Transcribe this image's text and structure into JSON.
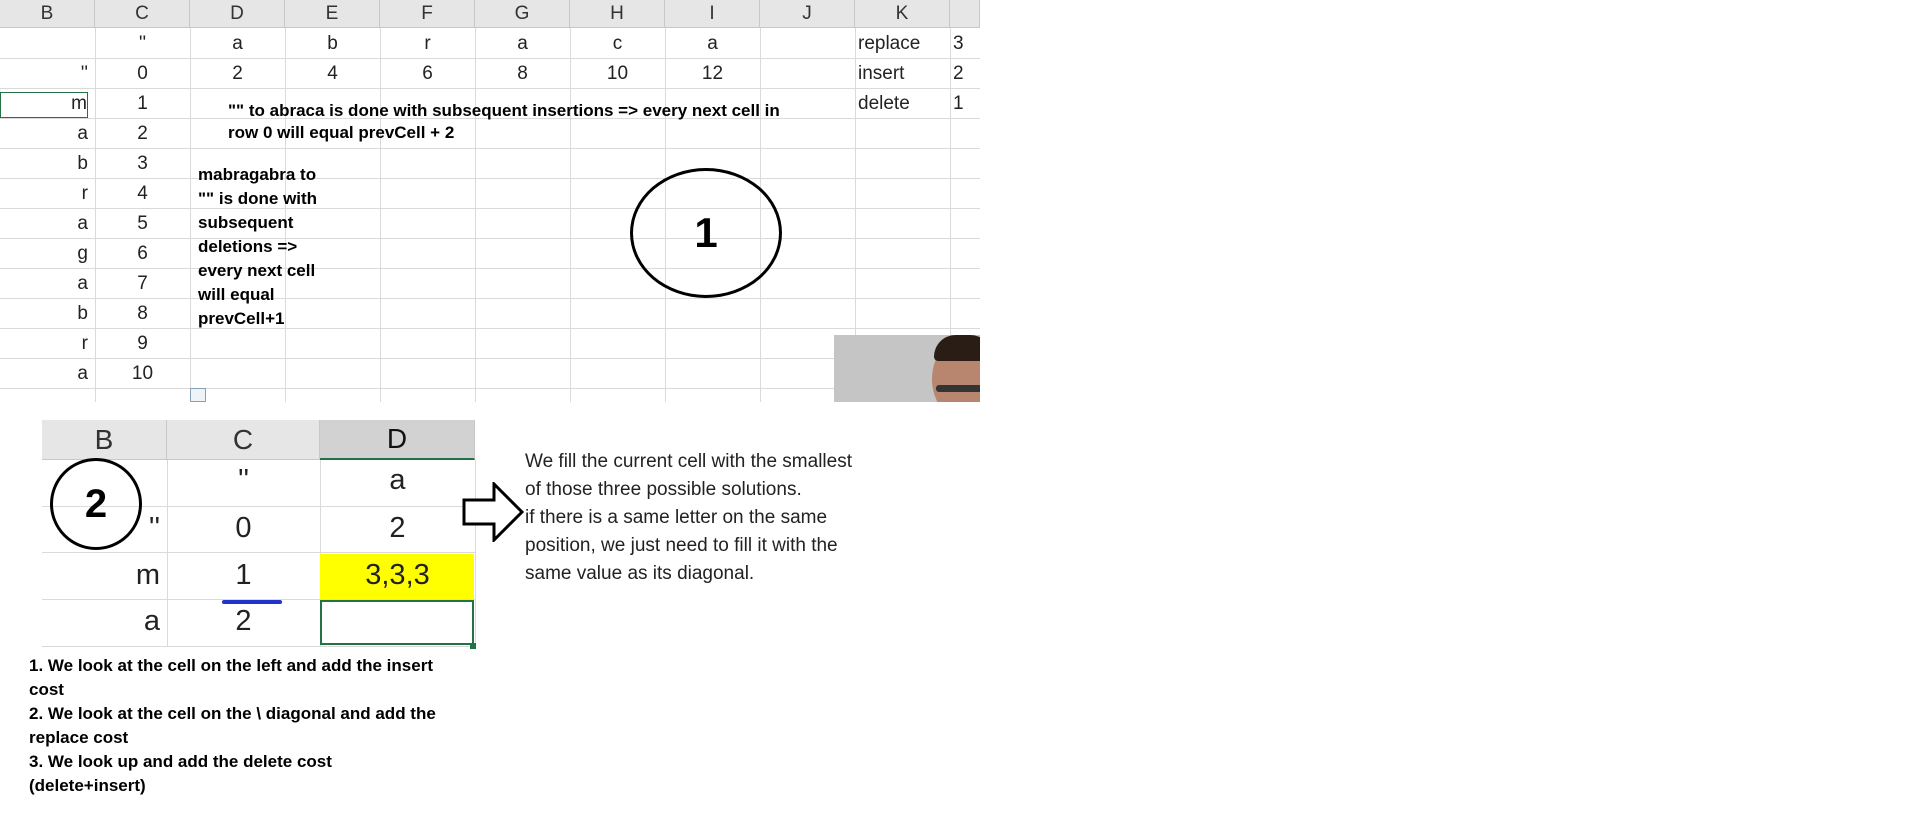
{
  "sheet1": {
    "columns": [
      "B",
      "C",
      "D",
      "E",
      "F",
      "G",
      "H",
      "I",
      "J",
      "K"
    ],
    "target_letters": [
      "a",
      "b",
      "r",
      "a",
      "c",
      "a"
    ],
    "first_row_values": [
      "0",
      "2",
      "4",
      "6",
      "8",
      "10",
      "12"
    ],
    "empty_mark": "''",
    "row_letters": [
      "m",
      "a",
      "b",
      "r",
      "a",
      "g",
      "a",
      "b",
      "r",
      "a"
    ],
    "row_values": [
      "1",
      "2",
      "3",
      "4",
      "5",
      "6",
      "7",
      "8",
      "9",
      "10"
    ],
    "costs": [
      {
        "label": "replace",
        "value": "3"
      },
      {
        "label": "insert",
        "value": "2"
      },
      {
        "label": "delete",
        "value": "1"
      }
    ],
    "note_row": [
      "\"\" to abraca is done with subsequent insertions => every next cell in",
      "row 0 will equal prevCell + 2"
    ],
    "note_col": [
      "mabragabra to",
      "\"\" is done with",
      "subsequent",
      "deletions =>",
      "every next cell",
      "will equal",
      "prevCell+1"
    ],
    "circle_label": "1"
  },
  "sheet2": {
    "columns": [
      "B",
      "C",
      "D"
    ],
    "circle_label": "2",
    "rows": [
      {
        "b": "",
        "c": "''",
        "d": "a"
      },
      {
        "b": "''",
        "c": "0",
        "d": "2"
      },
      {
        "b": "m",
        "c": "1",
        "d": "3,3,3"
      },
      {
        "b": "a",
        "c": "2",
        "d": ""
      }
    ],
    "highlight_color": "#ffff00"
  },
  "explanation": [
    "We fill the current cell with the smallest",
    "of those three possible solutions.",
    "if there is a same letter on the same",
    "position, we just need to fill it with the",
    "same value as its diagonal."
  ],
  "steps": [
    "1. We look at the cell on the left and add the insert",
    "cost",
    "2. We look at the cell on the \\ diagonal and add the",
    "replace cost",
    "3. We look up and add the delete cost",
    "(delete+insert)"
  ]
}
